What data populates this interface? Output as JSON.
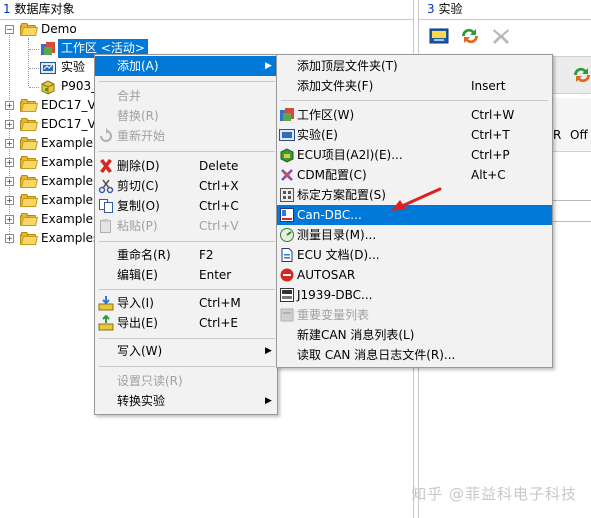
{
  "left_pane": {
    "title_num": "1",
    "title_text": " 数据库对象",
    "tree": [
      {
        "label": "Demo"
      },
      {
        "label": "工作区 <活动>"
      },
      {
        "label": "实验"
      },
      {
        "label": "P903_"
      },
      {
        "label": "EDC17_V"
      },
      {
        "label": "EDC17_V"
      },
      {
        "label": "Example"
      },
      {
        "label": "Example"
      },
      {
        "label": "Example"
      },
      {
        "label": "Example"
      },
      {
        "label": "Example"
      },
      {
        "label": "Examples"
      }
    ]
  },
  "right_pane": {
    "title_num": "3",
    "title_text": " 实验",
    "col_r": "R",
    "col_off": "Off"
  },
  "context_menu": {
    "items": [
      {
        "label": "添加(A)",
        "shortcut": "",
        "state": "highlight",
        "submenu": true
      },
      {
        "label": "合并",
        "shortcut": "",
        "state": "disabled"
      },
      {
        "label": "替换(R)",
        "shortcut": "",
        "state": "disabled"
      },
      {
        "label": "重新开始",
        "shortcut": "",
        "state": "disabled"
      },
      {
        "label": "删除(D)",
        "shortcut": "Delete",
        "state": "normal"
      },
      {
        "label": "剪切(C)",
        "shortcut": "Ctrl+X",
        "state": "normal"
      },
      {
        "label": "复制(O)",
        "shortcut": "Ctrl+C",
        "state": "normal"
      },
      {
        "label": "粘贴(P)",
        "shortcut": "Ctrl+V",
        "state": "disabled"
      },
      {
        "label": "重命名(R)",
        "shortcut": "F2",
        "state": "normal"
      },
      {
        "label": "编辑(E)",
        "shortcut": "Enter",
        "state": "normal"
      },
      {
        "label": "导入(I)",
        "shortcut": "Ctrl+M",
        "state": "normal"
      },
      {
        "label": "导出(E)",
        "shortcut": "Ctrl+E",
        "state": "normal"
      },
      {
        "label": "写入(W)",
        "shortcut": "",
        "state": "normal",
        "submenu": true
      },
      {
        "label": "设置只读(R)",
        "shortcut": "",
        "state": "disabled"
      },
      {
        "label": "转换实验",
        "shortcut": "",
        "state": "normal",
        "submenu": true
      }
    ]
  },
  "add_submenu": {
    "items": [
      {
        "label": "添加顶层文件夹(T)",
        "shortcut": ""
      },
      {
        "label": "添加文件夹(F)",
        "shortcut": "Insert"
      },
      {
        "label": "工作区(W)",
        "shortcut": "Ctrl+W"
      },
      {
        "label": "实验(E)",
        "shortcut": "Ctrl+T"
      },
      {
        "label": "ECU项目(A2l)(E)...",
        "shortcut": "Ctrl+P"
      },
      {
        "label": "CDM配置(C)",
        "shortcut": "Alt+C"
      },
      {
        "label": "标定方案配置(S)",
        "shortcut": ""
      },
      {
        "label": "Can-DBC...",
        "shortcut": ""
      },
      {
        "label": "测量目录(M)...",
        "shortcut": ""
      },
      {
        "label": "ECU 文档(D)...",
        "shortcut": ""
      },
      {
        "label": "AUTOSAR",
        "shortcut": ""
      },
      {
        "label": "J1939-DBC...",
        "shortcut": ""
      },
      {
        "label": "重要变量列表",
        "shortcut": ""
      },
      {
        "label": "新建CAN 消息列表(L)",
        "shortcut": ""
      },
      {
        "label": "读取 CAN 消息日志文件(R)...",
        "shortcut": ""
      }
    ]
  },
  "colors": {
    "highlight": "#0078d7",
    "annotation_arrow": "#e02020",
    "menu_bg": "#f2f2f2",
    "folder": "#e8b834"
  },
  "watermark": "知乎 @菲益科电子科技"
}
